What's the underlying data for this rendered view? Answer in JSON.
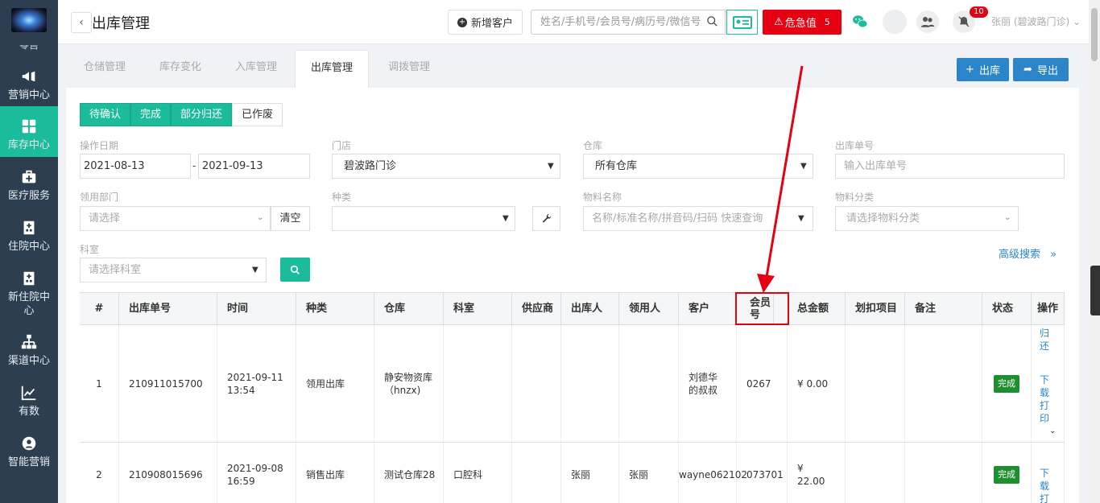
{
  "sidebar": {
    "clipped_label": "零售",
    "items": [
      {
        "label": "营销中心",
        "icon": "megaphone-icon"
      },
      {
        "label": "库存中心",
        "icon": "grid-icon",
        "active": true
      },
      {
        "label": "医疗服务",
        "icon": "medkit-icon"
      },
      {
        "label": "住院中心",
        "icon": "hospital-icon"
      },
      {
        "label": "新住院中心",
        "icon": "building-icon"
      },
      {
        "label": "渠道中心",
        "icon": "sitemap-icon"
      },
      {
        "label": "有数",
        "icon": "chart-icon"
      },
      {
        "label": "智能营销",
        "icon": "brain-icon"
      }
    ]
  },
  "header": {
    "title": "出库管理",
    "new_customer": "新增客户",
    "search_placeholder": "姓名/手机号/会员号/病历号/微信号",
    "critical_label": "危急值",
    "critical_count": "5",
    "bell_count": "10",
    "user": "张丽 (碧波路门诊)"
  },
  "tabs": [
    "仓储管理",
    "库存变化",
    "入库管理",
    "出库管理",
    "调拨管理"
  ],
  "actions": {
    "out": "出库",
    "export": "导出"
  },
  "status_filters": [
    "待确认",
    "完成",
    "部分归还",
    "已作废"
  ],
  "filters": {
    "date_label": "操作日期",
    "date_from": "2021-08-13",
    "date_sep": "-",
    "date_to": "2021-09-13",
    "store_label": "门店",
    "store_value": "碧波路门诊",
    "warehouse_label": "仓库",
    "warehouse_value": "所有仓库",
    "order_no_label": "出库单号",
    "order_no_placeholder": "输入出库单号",
    "dept_label": "领用部门",
    "dept_placeholder": "请选择",
    "clear": "清空",
    "kind_label": "种类",
    "kind_value": "",
    "material_label": "物料名称",
    "material_placeholder": "名称/标准名称/拼音码/扫码 快速查询",
    "material_cat_label": "物料分类",
    "material_cat_placeholder": "请选择物料分类",
    "room_label": "科室",
    "room_placeholder": "请选择科室",
    "advanced": "高级搜索"
  },
  "table": {
    "headers": [
      "#",
      "出库单号",
      "时间",
      "种类",
      "仓库",
      "科室",
      "供应商",
      "出库人",
      "领用人",
      "客户",
      "会员号",
      "总金额",
      "划扣项目",
      "备注",
      "状态",
      "操作"
    ],
    "rows": [
      {
        "no": "1",
        "order": "210911015700",
        "time": "2021-09-11 13:54",
        "kind": "领用出库",
        "warehouse": "静安物资库（hnzx)",
        "room": "",
        "supplier": "",
        "issuer": "",
        "receiver": "",
        "customer": "刘德华的叔叔",
        "member": "0267",
        "amount": "¥ 0.00",
        "deduct": "",
        "note": "",
        "status": "完成",
        "op1": "归还",
        "op2": "下载打印"
      },
      {
        "no": "2",
        "order": "210908015696",
        "time": "2021-09-08 16:59",
        "kind": "销售出库",
        "warehouse": "测试仓库28",
        "room": "口腔科",
        "supplier": "",
        "issuer": "张丽",
        "receiver": "张丽",
        "customer": "wayne062102",
        "member": "073701",
        "amount": "¥ 22.00",
        "deduct": "",
        "note": "",
        "status": "完成",
        "op1": "",
        "op2": "下载打印"
      }
    ]
  },
  "colors": {
    "sidebar": "#2c3e50",
    "teal": "#1bbc9b",
    "blue": "#2d85c9",
    "danger": "#e50012",
    "done": "#1e8f2e"
  }
}
